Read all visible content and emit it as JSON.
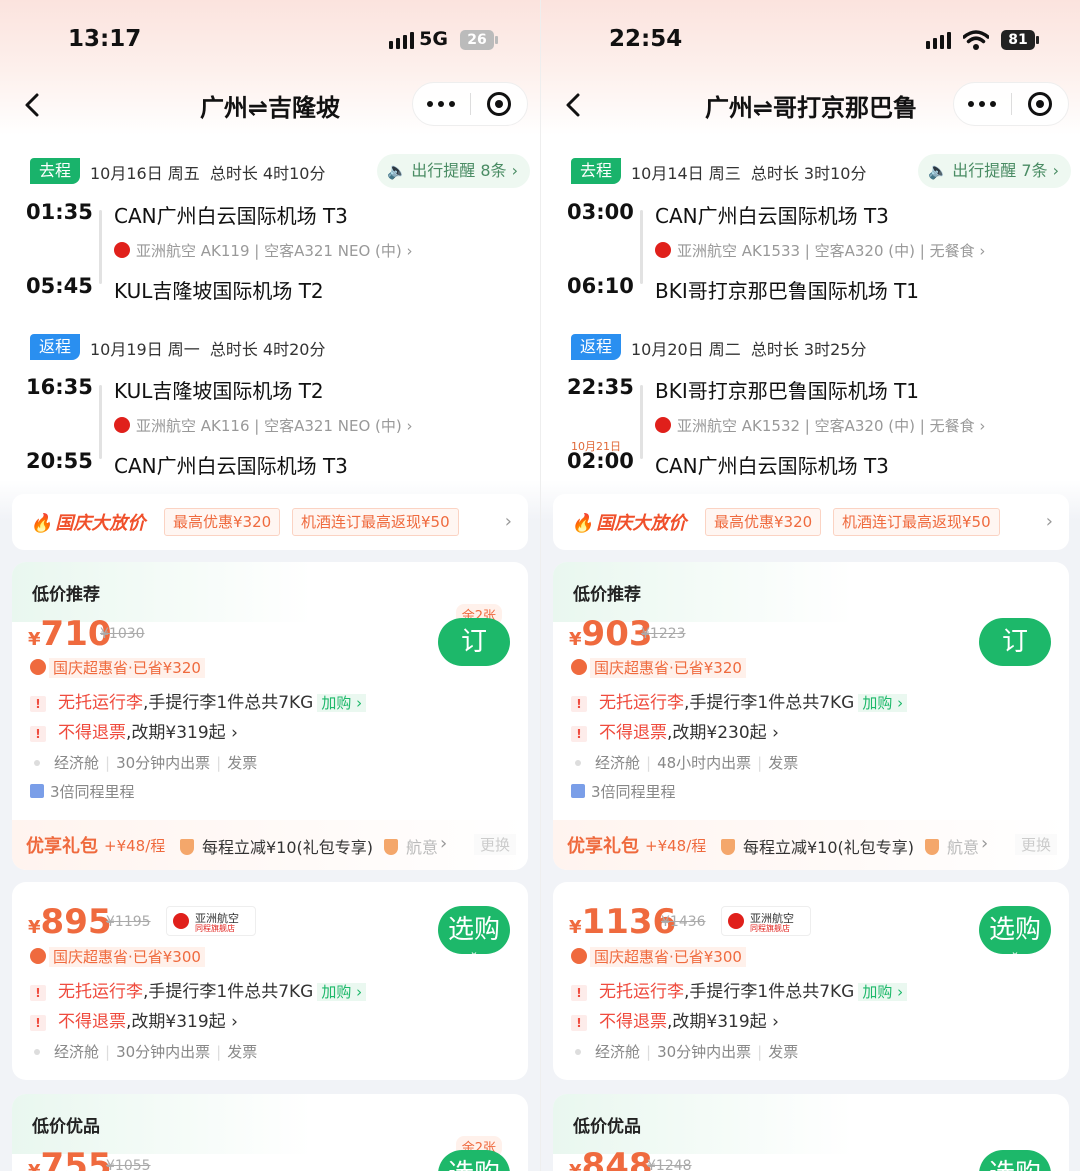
{
  "screens": [
    {
      "status": {
        "time": "13:17",
        "network": "5G",
        "battery": "26"
      },
      "nav": {
        "title": "广州⇌吉隆坡"
      },
      "outbound": {
        "tag": "去程",
        "date": "10月16日 周五",
        "duration": "总时长 4时10分",
        "reminder": "出行提醒 8条",
        "dep_time": "01:35",
        "dep_airport": "CAN广州白云国际机场 T3",
        "flight_detail": "亚洲航空 AK119 | 空客A321 NEO (中) ›",
        "arr_time": "05:45",
        "arr_airport": "KUL吉隆坡国际机场 T2",
        "arr_nextday": ""
      },
      "inbound": {
        "tag": "返程",
        "date": "10月19日 周一",
        "duration": "总时长 4时20分",
        "dep_time": "16:35",
        "dep_airport": "KUL吉隆坡国际机场 T2",
        "flight_detail": "亚洲航空 AK116 | 空客A321 NEO (中) ›",
        "arr_time": "20:55",
        "arr_airport": "CAN广州白云国际机场 T3",
        "arr_nextday": ""
      },
      "promo": {
        "title": "国庆大放价",
        "chip1": "最高优惠¥320",
        "chip2": "机酒连订最高返现¥50"
      },
      "card1": {
        "header": "低价推荐",
        "yen": "¥",
        "price": "710",
        "original": "¥1030",
        "left": "余2张",
        "savings": "国庆超惠省·已省¥320",
        "book": "订",
        "baggage_red": "无托运行李",
        "baggage_rest": ",手提行李1件总共7KG",
        "addon": "加购 ›",
        "refund_red": "不得退票",
        "refund_rest": ",改期¥319起 ›",
        "cabin": "经济舱",
        "issue": "30分钟内出票",
        "invoice": "发票",
        "mileage": "3倍同程里程",
        "gift_title": "优享礼包",
        "gift_price": "+¥48/程",
        "gift_item": "每程立减¥10(礼包专享)",
        "gift_more": "航意",
        "gift_change": "更换"
      },
      "card2": {
        "yen": "¥",
        "price": "895",
        "original": "¥1195",
        "airline": "亚洲航空",
        "airline_sub": "同程旗舰店",
        "savings": "国庆超惠省·已省¥300",
        "book": "选购",
        "baggage_red": "无托运行李",
        "baggage_rest": ",手提行李1件总共7KG",
        "addon": "加购 ›",
        "refund_red": "不得退票",
        "refund_rest": ",改期¥319起 ›",
        "cabin": "经济舱",
        "issue": "30分钟内出票",
        "invoice": "发票"
      },
      "card3": {
        "header": "低价优品",
        "price": "755",
        "original": "¥1055",
        "left": "余2张",
        "book": "选购"
      }
    },
    {
      "status": {
        "time": "22:54",
        "network": "wifi",
        "battery": "81"
      },
      "nav": {
        "title": "广州⇌哥打京那巴鲁"
      },
      "outbound": {
        "tag": "去程",
        "date": "10月14日 周三",
        "duration": "总时长 3时10分",
        "reminder": "出行提醒 7条",
        "dep_time": "03:00",
        "dep_airport": "CAN广州白云国际机场 T3",
        "flight_detail": "亚洲航空 AK1533 | 空客A320 (中) | 无餐食 ›",
        "arr_time": "06:10",
        "arr_airport": "BKI哥打京那巴鲁国际机场 T1",
        "arr_nextday": ""
      },
      "inbound": {
        "tag": "返程",
        "date": "10月20日 周二",
        "duration": "总时长 3时25分",
        "dep_time": "22:35",
        "dep_airport": "BKI哥打京那巴鲁国际机场 T1",
        "flight_detail": "亚洲航空 AK1532 | 空客A320 (中) | 无餐食 ›",
        "arr_time": "02:00",
        "arr_airport": "CAN广州白云国际机场 T3",
        "arr_nextday": "10月21日"
      },
      "promo": {
        "title": "国庆大放价",
        "chip1": "最高优惠¥320",
        "chip2": "机酒连订最高返现¥50"
      },
      "card1": {
        "header": "低价推荐",
        "yen": "¥",
        "price": "903",
        "original": "¥1223",
        "left": "",
        "savings": "国庆超惠省·已省¥320",
        "book": "订",
        "baggage_red": "无托运行李",
        "baggage_rest": ",手提行李1件总共7KG",
        "addon": "加购 ›",
        "refund_red": "不得退票",
        "refund_rest": ",改期¥230起 ›",
        "cabin": "经济舱",
        "issue": "48小时内出票",
        "invoice": "发票",
        "mileage": "3倍同程里程",
        "gift_title": "优享礼包",
        "gift_price": "+¥48/程",
        "gift_item": "每程立减¥10(礼包专享)",
        "gift_more": "航意",
        "gift_change": "更换"
      },
      "card2": {
        "yen": "¥",
        "price": "1136",
        "original": "¥1436",
        "airline": "亚洲航空",
        "airline_sub": "同程旗舰店",
        "savings": "国庆超惠省·已省¥300",
        "book": "选购",
        "baggage_red": "无托运行李",
        "baggage_rest": ",手提行李1件总共7KG",
        "addon": "加购 ›",
        "refund_red": "不得退票",
        "refund_rest": ",改期¥319起 ›",
        "cabin": "经济舱",
        "issue": "30分钟内出票",
        "invoice": "发票"
      },
      "card3": {
        "header": "低价优品",
        "price": "848",
        "original": "¥1248",
        "left": "",
        "book": "选购"
      }
    }
  ]
}
